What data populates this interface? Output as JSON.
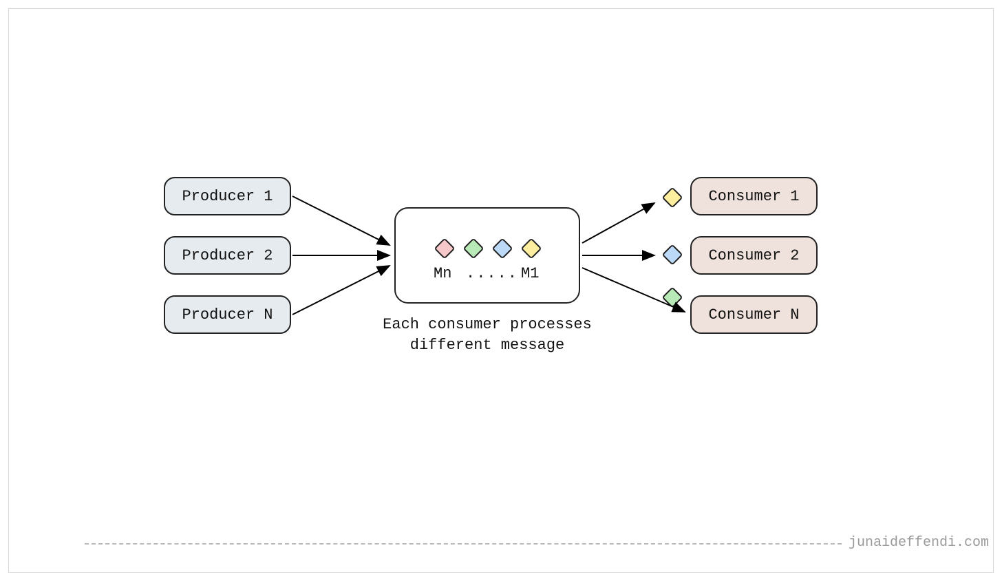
{
  "producers": [
    {
      "label": "Producer 1"
    },
    {
      "label": "Producer 2"
    },
    {
      "label": "Producer N"
    }
  ],
  "consumers": [
    {
      "label": "Consumer 1",
      "msg_color": "yellow"
    },
    {
      "label": "Consumer 2",
      "msg_color": "blue"
    },
    {
      "label": "Consumer N",
      "msg_color": "green"
    }
  ],
  "queue": {
    "messages": [
      {
        "color": "pink"
      },
      {
        "color": "green"
      },
      {
        "color": "blue"
      },
      {
        "color": "yellow"
      }
    ],
    "label_left": "Mn",
    "label_mid": ".....",
    "label_right": "M1"
  },
  "caption_line1": "Each consumer processes",
  "caption_line2": "different message",
  "footer_text": "junaideffendi.com"
}
